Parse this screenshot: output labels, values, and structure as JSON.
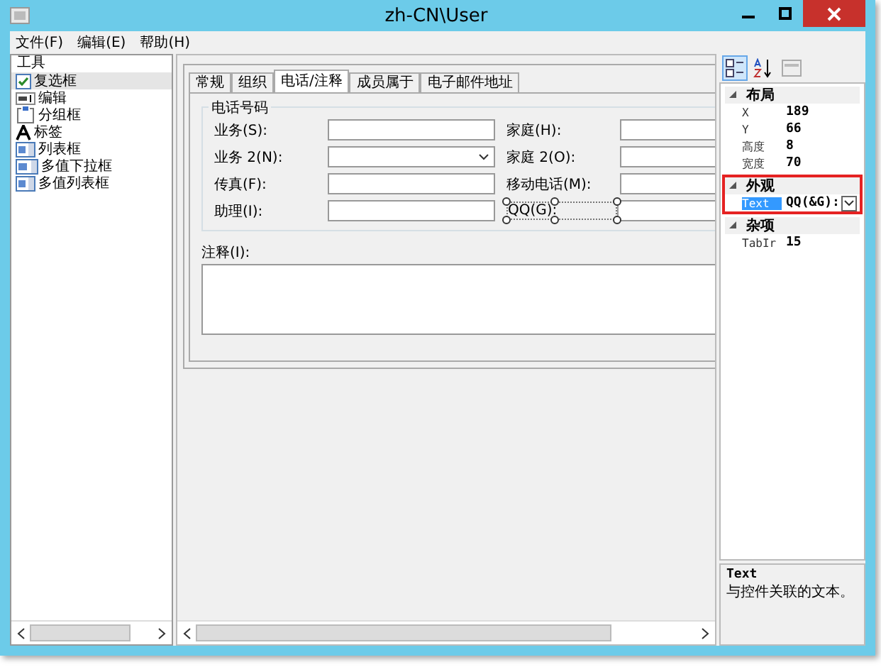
{
  "window": {
    "title": "zh-CN\\User"
  },
  "menu": [
    {
      "label": "文件(F)"
    },
    {
      "label": "编辑(E)"
    },
    {
      "label": "帮助(H)"
    }
  ],
  "toolbox": {
    "header": "工具",
    "items": [
      {
        "label": "复选框",
        "kind": "checkbox",
        "selected": true
      },
      {
        "label": "编辑",
        "kind": "edit",
        "selected": false
      },
      {
        "label": "分组框",
        "kind": "group",
        "selected": false
      },
      {
        "label": "标签",
        "kind": "label",
        "selected": false
      },
      {
        "label": "列表框",
        "kind": "list",
        "selected": false
      },
      {
        "label": "多值下拉框",
        "kind": "combo",
        "selected": false
      },
      {
        "label": "多值列表框",
        "kind": "list",
        "selected": false
      }
    ]
  },
  "tabs": [
    {
      "label": "常规",
      "selected": false
    },
    {
      "label": "组织",
      "selected": false
    },
    {
      "label": "电话/注释",
      "selected": true
    },
    {
      "label": "成员属于",
      "selected": false
    },
    {
      "label": "电子邮件地址",
      "selected": false
    }
  ],
  "phone_group": {
    "title": "电话号码",
    "left_fields": [
      {
        "label": "业务(S):",
        "kind": "text",
        "selected": false
      },
      {
        "label": "业务 2(N):",
        "kind": "dropdown",
        "selected": false
      },
      {
        "label": "传真(F):",
        "kind": "text",
        "selected": false
      },
      {
        "label": "助理(I):",
        "kind": "text",
        "selected": false
      }
    ],
    "right_fields": [
      {
        "label": "家庭(H):",
        "kind": "text",
        "selected": false
      },
      {
        "label": "家庭 2(O):",
        "kind": "text",
        "selected": false
      },
      {
        "label": "移动电话(M):",
        "kind": "text",
        "selected": false
      },
      {
        "label": "QQ(G):",
        "kind": "text",
        "selected": true
      }
    ]
  },
  "notes": {
    "label": "注释(I):"
  },
  "properties": {
    "categories": [
      {
        "name": "布局",
        "expanded": true,
        "highlighted": false,
        "rows": [
          {
            "name": "X",
            "value": "189",
            "selected": false,
            "kind": "text"
          },
          {
            "name": "Y",
            "value": "66",
            "selected": false,
            "kind": "text"
          },
          {
            "name": "高度",
            "value": "8",
            "selected": false,
            "kind": "text"
          },
          {
            "name": "宽度",
            "value": "70",
            "selected": false,
            "kind": "text"
          }
        ]
      },
      {
        "name": "外观",
        "expanded": true,
        "highlighted": true,
        "rows": [
          {
            "name": "Text",
            "value": "QQ(&G):",
            "selected": true,
            "kind": "dropdown"
          }
        ]
      },
      {
        "name": "杂项",
        "expanded": true,
        "highlighted": false,
        "rows": [
          {
            "name": "TabIr",
            "value": "15",
            "selected": false,
            "kind": "text"
          }
        ]
      }
    ],
    "description": {
      "title": "Text",
      "text": "与控件关联的文本。"
    }
  }
}
